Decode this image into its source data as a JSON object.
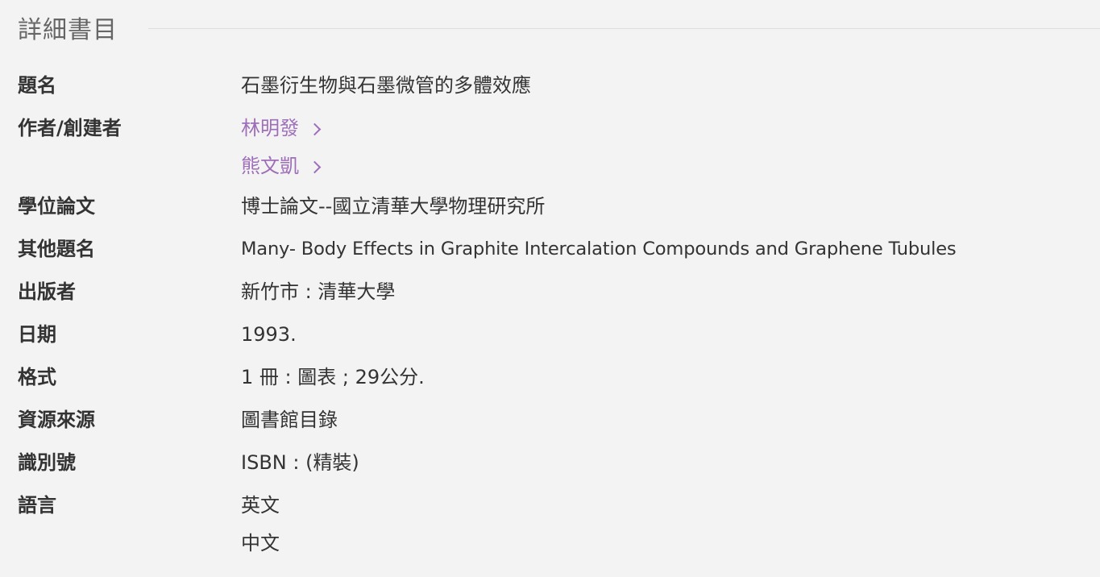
{
  "section": {
    "title": "詳細書目"
  },
  "fields": {
    "title": {
      "label": "題名",
      "value": "石墨衍生物與石墨微管的多體效應"
    },
    "authors": {
      "label": "作者/創建者",
      "items": [
        "林明發",
        "熊文凱"
      ]
    },
    "thesis": {
      "label": "學位論文",
      "value": "博士論文--國立清華大學物理研究所"
    },
    "other_title": {
      "label": "其他題名",
      "value": "Many- Body Effects in Graphite Intercalation Compounds and Graphene Tubules"
    },
    "publisher": {
      "label": "出版者",
      "value": "新竹市 : 清華大學"
    },
    "date": {
      "label": "日期",
      "value": "1993."
    },
    "format": {
      "label": "格式",
      "value": "1 冊 : 圖表 ; 29公分."
    },
    "source": {
      "label": "資源來源",
      "value": "圖書館目錄"
    },
    "identifier": {
      "label": "識別號",
      "value": "ISBN : (精裝)"
    },
    "language": {
      "label": "語言",
      "items": [
        "英文",
        "中文"
      ]
    }
  },
  "colors": {
    "background": "#f3f3f3",
    "text": "#333333",
    "link": "#9e6fb8",
    "heading": "#666666"
  },
  "icons": {
    "author_link": "chevron-right-icon"
  }
}
